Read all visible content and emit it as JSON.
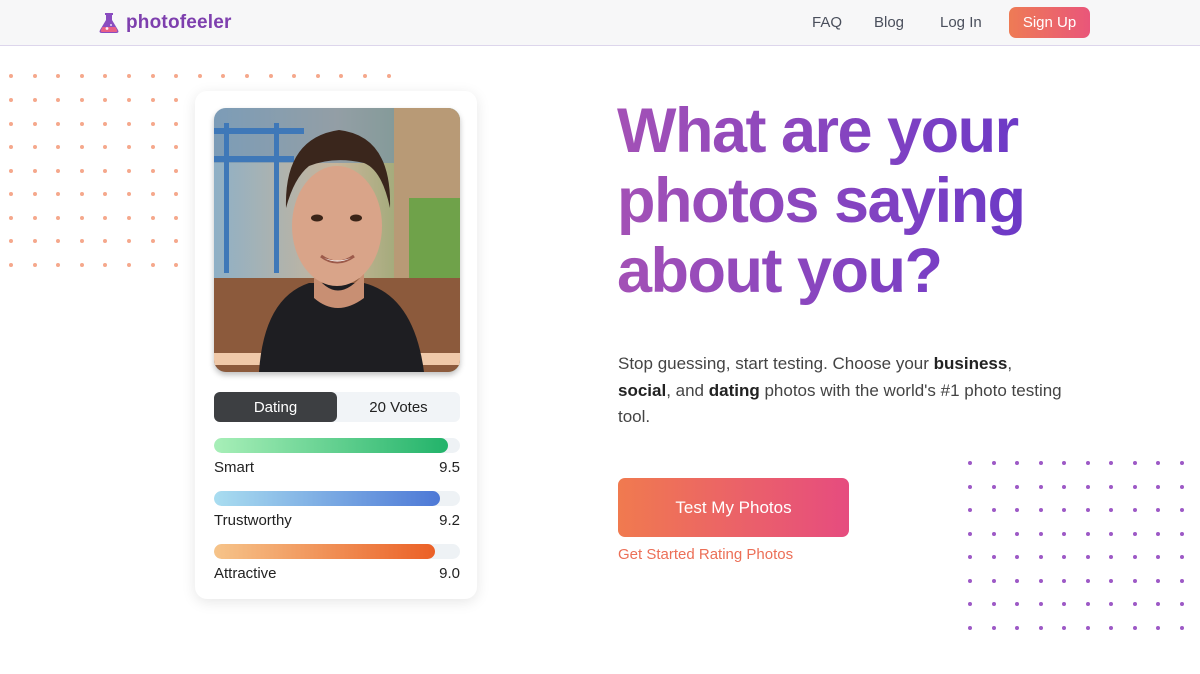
{
  "header": {
    "logo_text": "photofeeler",
    "logo_icon": "flask-icon",
    "nav": [
      {
        "label": "FAQ"
      },
      {
        "label": "Blog"
      },
      {
        "label": "Log In"
      }
    ],
    "signup_label": "Sign Up"
  },
  "card": {
    "photo_alt": "profile-photo",
    "tabs": {
      "active": "Dating",
      "votes": "20 Votes"
    },
    "metrics": [
      {
        "label": "Smart",
        "score": "9.5",
        "level": 0.95
      },
      {
        "label": "Trustworthy",
        "score": "9.2",
        "level": 0.92
      },
      {
        "label": "Attractive",
        "score": "9.0",
        "level": 0.9
      }
    ]
  },
  "hero": {
    "headline": [
      "What are your",
      "photos saying",
      "about you?"
    ],
    "desc_1": "Stop guessing, start testing. Choose your ",
    "desc_bold_1": "business",
    "desc_2": ",",
    "desc_bold_2": "social",
    "desc_3": ", and ",
    "desc_bold_3": "dating",
    "desc_4": " photos with the world's #1 photo testing tool.",
    "cta_label": "Test My Photos",
    "sublink": "Get Started Rating Photos"
  },
  "colors": {
    "brand_purple": "#7e3fae",
    "accent_coral": "#ec6f57",
    "bar_smart": [
      "#a8efb8",
      "#22b36a"
    ],
    "bar_trustworthy": [
      "#a9ddf0",
      "#4d78d6"
    ],
    "bar_attractive": [
      "#f6c48a",
      "#eb6026"
    ]
  }
}
